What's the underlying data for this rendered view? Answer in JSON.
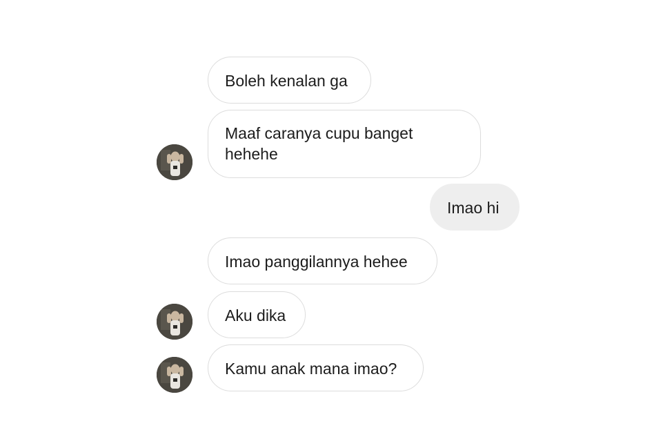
{
  "messages": [
    {
      "text": "Boleh kenalan ga",
      "sender": "incoming"
    },
    {
      "text": "Maaf caranya cupu banget hehehe",
      "sender": "incoming"
    },
    {
      "text": "Imao hi",
      "sender": "outgoing"
    },
    {
      "text": "Imao panggilannya hehee",
      "sender": "incoming"
    },
    {
      "text": "Aku dika",
      "sender": "incoming"
    },
    {
      "text": "Kamu anak mana imao?",
      "sender": "incoming"
    }
  ],
  "avatar": {
    "icon": "contact-avatar-icon"
  },
  "colors": {
    "incoming_bubble": "#ffffff",
    "incoming_border": "#dcdcdc",
    "outgoing_bubble": "#eeeeee",
    "text": "#1c1c1c"
  }
}
